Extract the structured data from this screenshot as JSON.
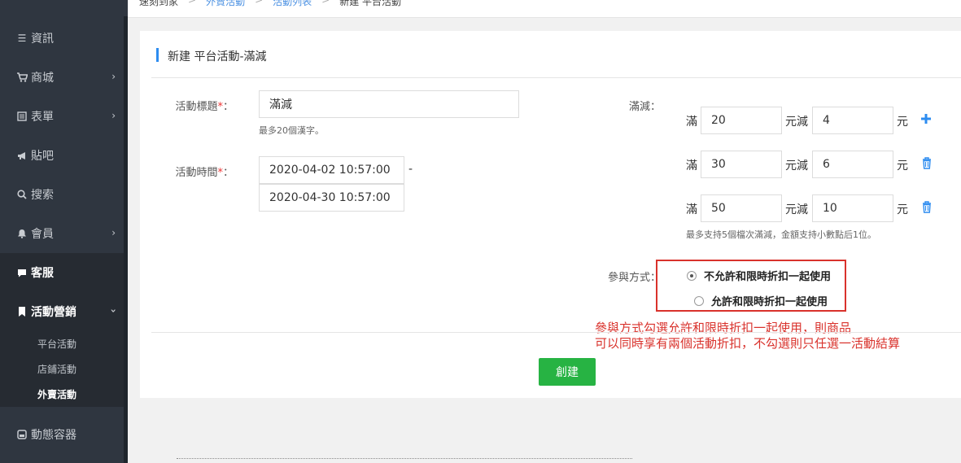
{
  "breadcrumb": {
    "items": [
      "速刻到家",
      "外賣活動",
      "活動列表",
      "新建 平台活動"
    ],
    "separator": ">"
  },
  "sidebar": {
    "items": [
      {
        "label": "資訊",
        "icon": "list-icon"
      },
      {
        "label": "商城",
        "icon": "cart-icon"
      },
      {
        "label": "表單",
        "icon": "form-icon"
      },
      {
        "label": "貼吧",
        "icon": "megaphone-icon"
      },
      {
        "label": "搜索",
        "icon": "search-icon"
      },
      {
        "label": "會員",
        "icon": "bell-icon"
      },
      {
        "label": "客服",
        "icon": "chat-icon"
      },
      {
        "label": "活動營銷",
        "icon": "bookmark-icon"
      },
      {
        "label": "動態容器",
        "icon": "container-icon"
      }
    ],
    "sub_items": [
      "平台活動",
      "店鋪活動",
      "外賣活動"
    ]
  },
  "form": {
    "title": "新建 平台活動-滿減",
    "activity_title": {
      "label": "活動標題",
      "required_mark": "*",
      "colon": "：",
      "value": "滿減",
      "help": "最多20個漢字。"
    },
    "activity_time": {
      "label": "活動時間",
      "required_mark": "*",
      "colon": "：",
      "start": "2020-04-02 10:57:00",
      "end": "2020-04-30 10:57:00",
      "dash": "-"
    },
    "discount": {
      "label": "滿減：",
      "prefix": "滿",
      "middle": "元減",
      "suffix": "元",
      "tiers": [
        {
          "threshold": "20",
          "reduce": "4"
        },
        {
          "threshold": "30",
          "reduce": "6"
        },
        {
          "threshold": "50",
          "reduce": "10"
        }
      ],
      "help": "最多支持5個檔次滿減，金額支持小數點后1位。"
    },
    "participation": {
      "label": "參與方式：",
      "options": [
        "不允許和限時折扣一起使用",
        "允許和限時折扣一起使用"
      ],
      "selected": "不允許和限時折扣一起使用"
    },
    "note_line1": "參與方式勾選允許和限時折扣一起使用，則商品",
    "note_line2": "可以同時享有兩個活動折扣，不勾選則只任選一活動結算",
    "create_label": "創建"
  },
  "colors": {
    "accent": "#2d8cf0",
    "primary_button": "#27b343",
    "annotation": "#d9322c",
    "sidebar": "#2f3640"
  }
}
